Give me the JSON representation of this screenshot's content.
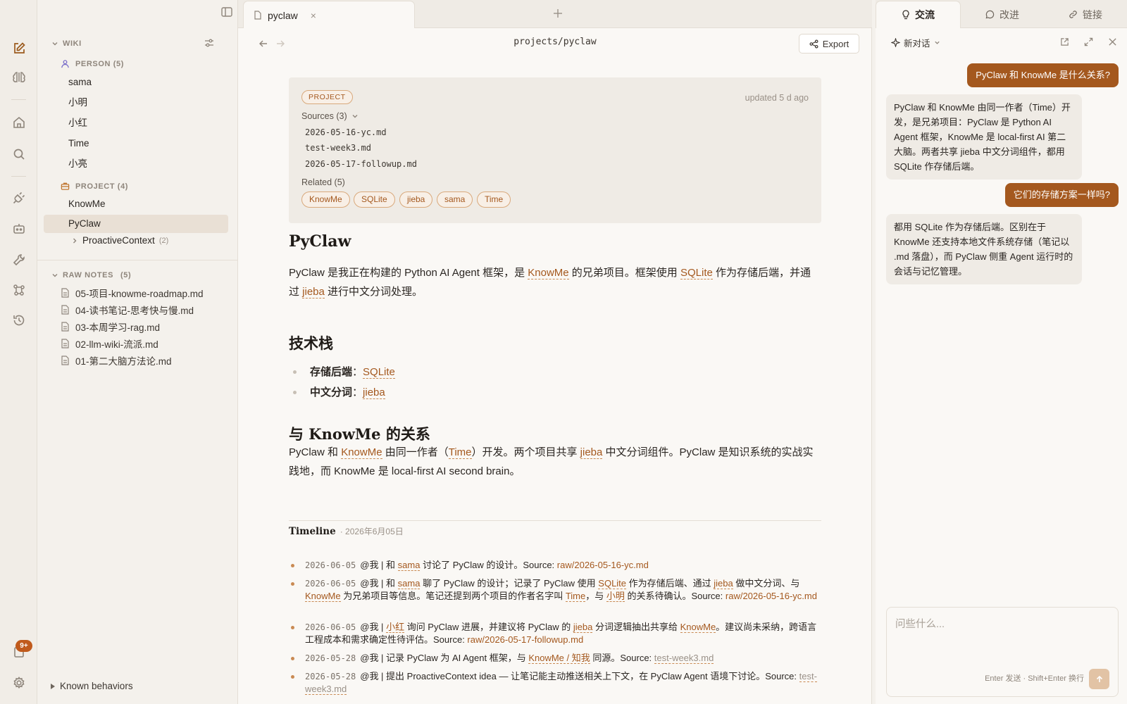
{
  "rail": {
    "badge": "9+"
  },
  "sidebar": {
    "wiki_label": "WIKI",
    "person_label": "PERSON (5)",
    "persons": [
      "sama",
      "小明",
      "小红",
      "Time",
      "小亮"
    ],
    "project_label": "PROJECT (4)",
    "projects": [
      "KnowMe",
      "PyClaw"
    ],
    "proactive": {
      "label": "ProactiveContext",
      "count": "(2)"
    },
    "raw_label": "RAW NOTES",
    "raw_count": "(5)",
    "raw_files": [
      "05-项目-knowme-roadmap.md",
      "04-读书笔记-思考快与慢.md",
      "03-本周学习-rag.md",
      "02-llm-wiki-流派.md",
      "01-第二大脑方法论.md"
    ],
    "known_behaviors": "Known behaviors"
  },
  "tabs": {
    "active": "pyclaw"
  },
  "main": {
    "path": "projects/pyclaw",
    "export": "Export",
    "meta": {
      "tag": "PROJECT",
      "updated": "updated 5 d ago",
      "sources_label": "Sources (3)",
      "sources": [
        "2026-05-16-yc.md",
        "test-week3.md",
        "2026-05-17-followup.md"
      ],
      "related_label": "Related (5)",
      "related": [
        "KnowMe",
        "SQLite",
        "jieba",
        "sama",
        "Time"
      ]
    },
    "title": "PyClaw",
    "intro": {
      "t1": "PyClaw 是我正在构建的 Python AI Agent 框架，是 ",
      "l1": "KnowMe",
      "t2": " 的兄弟项目。框架使用 ",
      "l2": "SQLite",
      "t3": " 作为存储后端，并通过 ",
      "l3": "jieba",
      "t4": " 进行中文分词处理。"
    },
    "tech_title": "技术栈",
    "tech": [
      {
        "label": "存储后端",
        "sep": "：",
        "link": "SQLite"
      },
      {
        "label": "中文分词",
        "sep": "：",
        "link": "jieba"
      }
    ],
    "rel_title": "与 KnowMe 的关系",
    "rel": {
      "t1": "PyClaw 和 ",
      "l1": "KnowMe",
      "t2": " 由同一作者（",
      "l2": "Time",
      "t3": "）开发。两个项目共享 ",
      "l3": "jieba",
      "t4": " 中文分词组件。PyClaw 是知识系统的实战实践地，而 KnowMe 是 local-first AI second brain。"
    },
    "timeline_title": "Timeline",
    "timeline_date": "· 2026年6月05日",
    "timeline": {
      "i1": {
        "date": "2026-06-05",
        "a": "@我 | 和 ",
        "b": "sama",
        "c": " 讨论了 PyClaw 的设计。Source: ",
        "d": "raw/2026-05-16-yc.md"
      },
      "i2": {
        "date": "2026-06-05",
        "a": "@我 | 和 ",
        "b": "sama",
        "c": " 聊了 PyClaw 的设计；记录了 PyClaw 使用 ",
        "d": "SQLite",
        "e": " 作为存储后端、通过 ",
        "f": "jieba",
        "g": " 做中文分词、与 ",
        "h": "KnowMe",
        "i": " 为兄弟项目等信息。笔记还提到两个项目的作者名字叫 ",
        "j": "Time",
        "k": "，与 ",
        "l": "小明",
        "m": " 的关系待确认。Source: ",
        "n": "raw/2026-05-16-yc.md"
      },
      "i3": {
        "date": "2026-06-05",
        "a": "@我 | ",
        "b": "小红",
        "c": " 询问 PyClaw 进展，并建议将 PyClaw 的 ",
        "d": "jieba",
        "e": " 分词逻辑抽出共享给 ",
        "f": "KnowMe",
        "g": "。建议尚未采纳，跨语言工程成本和需求确定性待评估。Source: ",
        "h": "raw/2026-05-17-followup.md"
      },
      "i4": {
        "date": "2026-05-28",
        "a": "@我 | 记录 PyClaw 为 AI Agent 框架，与 ",
        "b": "KnowMe / 知我",
        "c": " 同源。Source: ",
        "d": "test-week3.md"
      },
      "i5": {
        "date": "2026-05-28",
        "a": "@我 | 提出 ProactiveContext idea — 让笔记能主动推送相关上下文，在 PyClaw Agent 语境下讨论。Source: ",
        "b": "test-week3.md"
      }
    }
  },
  "right": {
    "tabs": [
      "交流",
      "改进",
      "链接"
    ],
    "new_chat": "新对话",
    "messages": [
      "PyClaw 和 KnowMe 是什么关系?",
      "PyClaw 和 KnowMe 由同一作者（Time）开发，是兄弟项目：PyClaw 是 Python AI Agent 框架，KnowMe 是 local-first AI 第二大脑。两者共享 jieba 中文分词组件，都用 SQLite 作存储后端。",
      "它们的存储方案一样吗?",
      "都用 SQLite 作为存储后端。区别在于 KnowMe 还支持本地文件系统存储（笔记以 .md 落盘），而 PyClaw 侧重 Agent 运行时的会话与记忆管理。"
    ],
    "input_placeholder": "问些什么...",
    "hint": "Enter 发送 · Shift+Enter 换行"
  },
  "colors": {
    "accent": "#a4581e",
    "accent_light": "#e2c3a5",
    "badge": "#c05a1c"
  }
}
